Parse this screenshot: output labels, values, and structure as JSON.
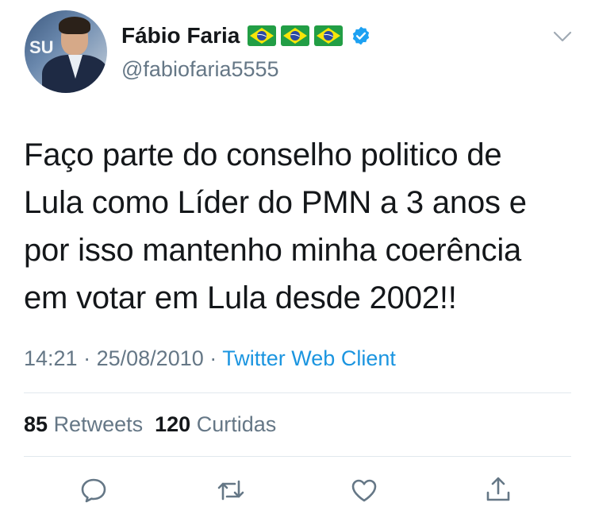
{
  "user": {
    "display_name": "Fábio Faria",
    "handle": "@fabiofaria5555",
    "flags": [
      "brazil-flag",
      "brazil-flag",
      "brazil-flag"
    ],
    "verified": true,
    "avatar_text": "SU"
  },
  "tweet": {
    "lines": [
      "Faço parte do conselho politico de",
      "Lula como Líder do PMN a 3 anos e",
      "por isso mantenho minha coerência",
      "em votar em Lula desde 2002!!"
    ],
    "time": "14:21",
    "date": "25/08/2010",
    "separator": "·",
    "source": "Twitter Web Client"
  },
  "stats": {
    "retweets_count": "85",
    "retweets_label": "Retweets",
    "likes_count": "120",
    "likes_label": "Curtidas"
  },
  "actions": [
    "reply-icon",
    "retweet-icon",
    "like-icon",
    "share-icon"
  ],
  "colors": {
    "text": "#14171a",
    "muted": "#657786",
    "link": "#1b95e0",
    "divider": "#e1e8ed"
  }
}
